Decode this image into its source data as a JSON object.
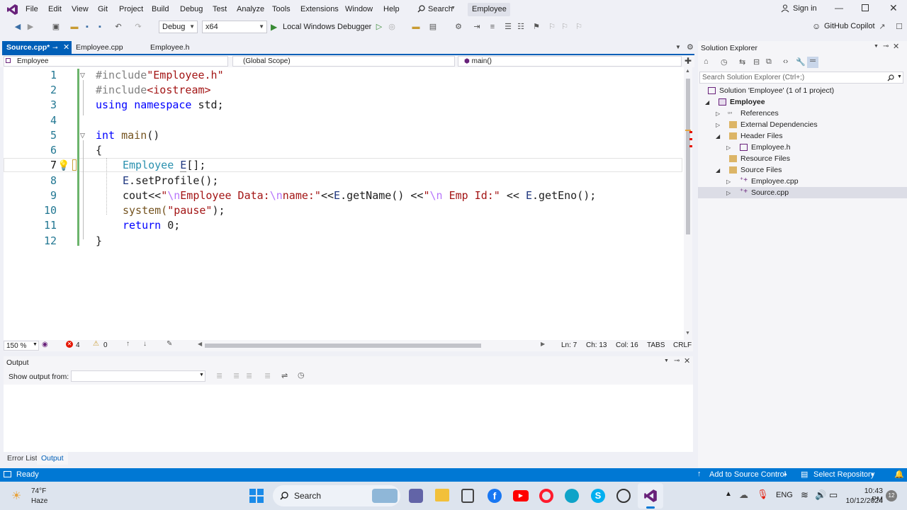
{
  "menu": {
    "items": [
      "File",
      "Edit",
      "View",
      "Git",
      "Project",
      "Build",
      "Debug",
      "Test",
      "Analyze",
      "Tools",
      "Extensions",
      "Window",
      "Help"
    ],
    "search_label": "Search",
    "solution_name": "Employee",
    "sign_in": "Sign in",
    "copilot": "GitHub Copilot"
  },
  "toolbar": {
    "config": "Debug",
    "platform": "x64",
    "debugger": "Local Windows Debugger"
  },
  "tabs": [
    {
      "label": "Source.cpp*",
      "active": true
    },
    {
      "label": "Employee.cpp",
      "active": false
    },
    {
      "label": "Employee.h",
      "active": false
    }
  ],
  "nav": {
    "project": "Employee",
    "scope": "(Global Scope)",
    "member": "main()"
  },
  "code": {
    "line_numbers": [
      "1",
      "2",
      "3",
      "4",
      "5",
      "6",
      "7",
      "8",
      "9",
      "10",
      "11",
      "12"
    ],
    "l1_pp": "#include",
    "l1_str": "\"Employee.h\"",
    "l2_pp": "#include",
    "l2_str": "<iostream>",
    "l3_kw1": "using",
    "l3_kw2": "namespace",
    "l3_rest": "std;",
    "l5_kw": "int",
    "l5_fn": "main",
    "l5_rest": "()",
    "l6": "{",
    "l7_ty": "Employee",
    "l7_var": "E",
    "l7_rest": "[];",
    "l8_var": "E",
    "l8_rest": ".setProfile();",
    "l9_a": "cout<<",
    "l9_b": "\"",
    "l9_c": "\\n",
    "l9_d": "Employee Data:",
    "l9_e": "\\n",
    "l9_f": "name:\"",
    "l9_g": "<<",
    "l9_h": "E",
    "l9_i": ".getName() <<",
    "l9_j": "\"",
    "l9_k": "\\n",
    "l9_l": " Emp Id:\"",
    "l9_m": " << ",
    "l9_n": "E",
    "l9_o": ".getEno();",
    "l10_a": "system(",
    "l10_b": "\"pause\"",
    "l10_c": ");",
    "l11_kw": "return",
    "l11_rest": " 0;",
    "l12": "}"
  },
  "editor_status": {
    "zoom": "150 %",
    "errors": "4",
    "warnings": "0",
    "ln": "Ln: 7",
    "ch": "Ch: 13",
    "col": "Col: 16",
    "tabs": "TABS",
    "eol": "CRLF"
  },
  "output": {
    "title": "Output",
    "show_from": "Show output from:"
  },
  "bottom_tabs": [
    "Error List",
    "Output"
  ],
  "solution_explorer": {
    "title": "Solution Explorer",
    "search_placeholder": "Search Solution Explorer (Ctrl+;)",
    "solution": "Solution 'Employee' (1 of 1 project)",
    "project": "Employee",
    "references": "References",
    "external": "External Dependencies",
    "header_files": "Header Files",
    "employee_h": "Employee.h",
    "resource_files": "Resource Files",
    "source_files": "Source Files",
    "employee_cpp": "Employee.cpp",
    "source_cpp": "Source.cpp"
  },
  "status_bar": {
    "ready": "Ready",
    "add_source": "Add to Source Control",
    "select_repo": "Select Repository"
  },
  "taskbar": {
    "weather_temp": "74°F",
    "weather_desc": "Haze",
    "search": "Search",
    "lang": "ENG",
    "time": "10:43 PM",
    "date": "10/12/2024",
    "notif_count": "12"
  },
  "colors": {
    "accent": "#0078d4",
    "active_tab": "#005fb8",
    "error": "#e51400"
  }
}
